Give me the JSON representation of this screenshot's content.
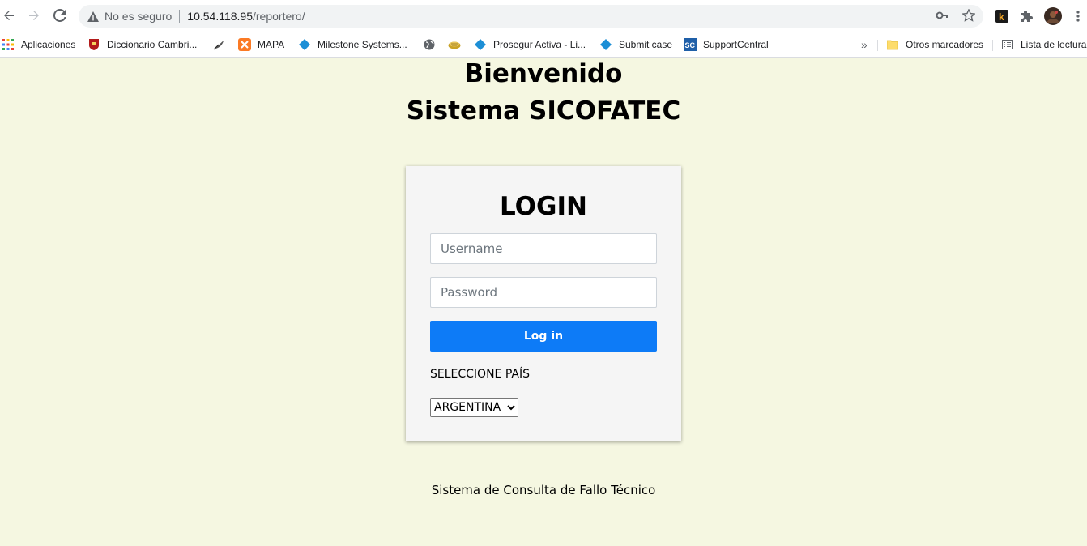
{
  "browser": {
    "security_label": "No es seguro",
    "url_host": "10.54.118.95",
    "url_path": "/reportero/"
  },
  "bookmarks": {
    "items": [
      {
        "label": "Aplicaciones",
        "icon": "apps-grid-icon"
      },
      {
        "label": "Diccionario Cambri...",
        "icon": "cambridge-icon"
      },
      {
        "label": "",
        "icon": "feather-icon"
      },
      {
        "label": "MAPA",
        "icon": "xampp-icon"
      },
      {
        "label": "Milestone Systems...",
        "icon": "diamond-icon"
      },
      {
        "label": "",
        "icon": "globe-icon"
      },
      {
        "label": "",
        "icon": "pie-icon"
      },
      {
        "label": "Prosegur Activa - Li...",
        "icon": "diamond-icon"
      },
      {
        "label": "Submit case",
        "icon": "diamond-icon"
      },
      {
        "label": "SupportCentral",
        "icon": "support-central-icon"
      }
    ],
    "overflow": "»",
    "other_folder": "Otros marcadores",
    "reading_list": "Lista de lectura"
  },
  "page": {
    "welcome": "Bienvenido",
    "system_name": "Sistema SICOFATEC",
    "footer": "Sistema de Consulta de Fallo Técnico"
  },
  "login": {
    "title": "LOGIN",
    "username_placeholder": "Username",
    "password_placeholder": "Password",
    "submit_label": "Log in",
    "country_label": "SELECCIONE PAÍS",
    "country_selected": "ARGENTINA"
  },
  "colors": {
    "page_background": "#f5f7e1",
    "button_primary": "#0d7bf7"
  }
}
